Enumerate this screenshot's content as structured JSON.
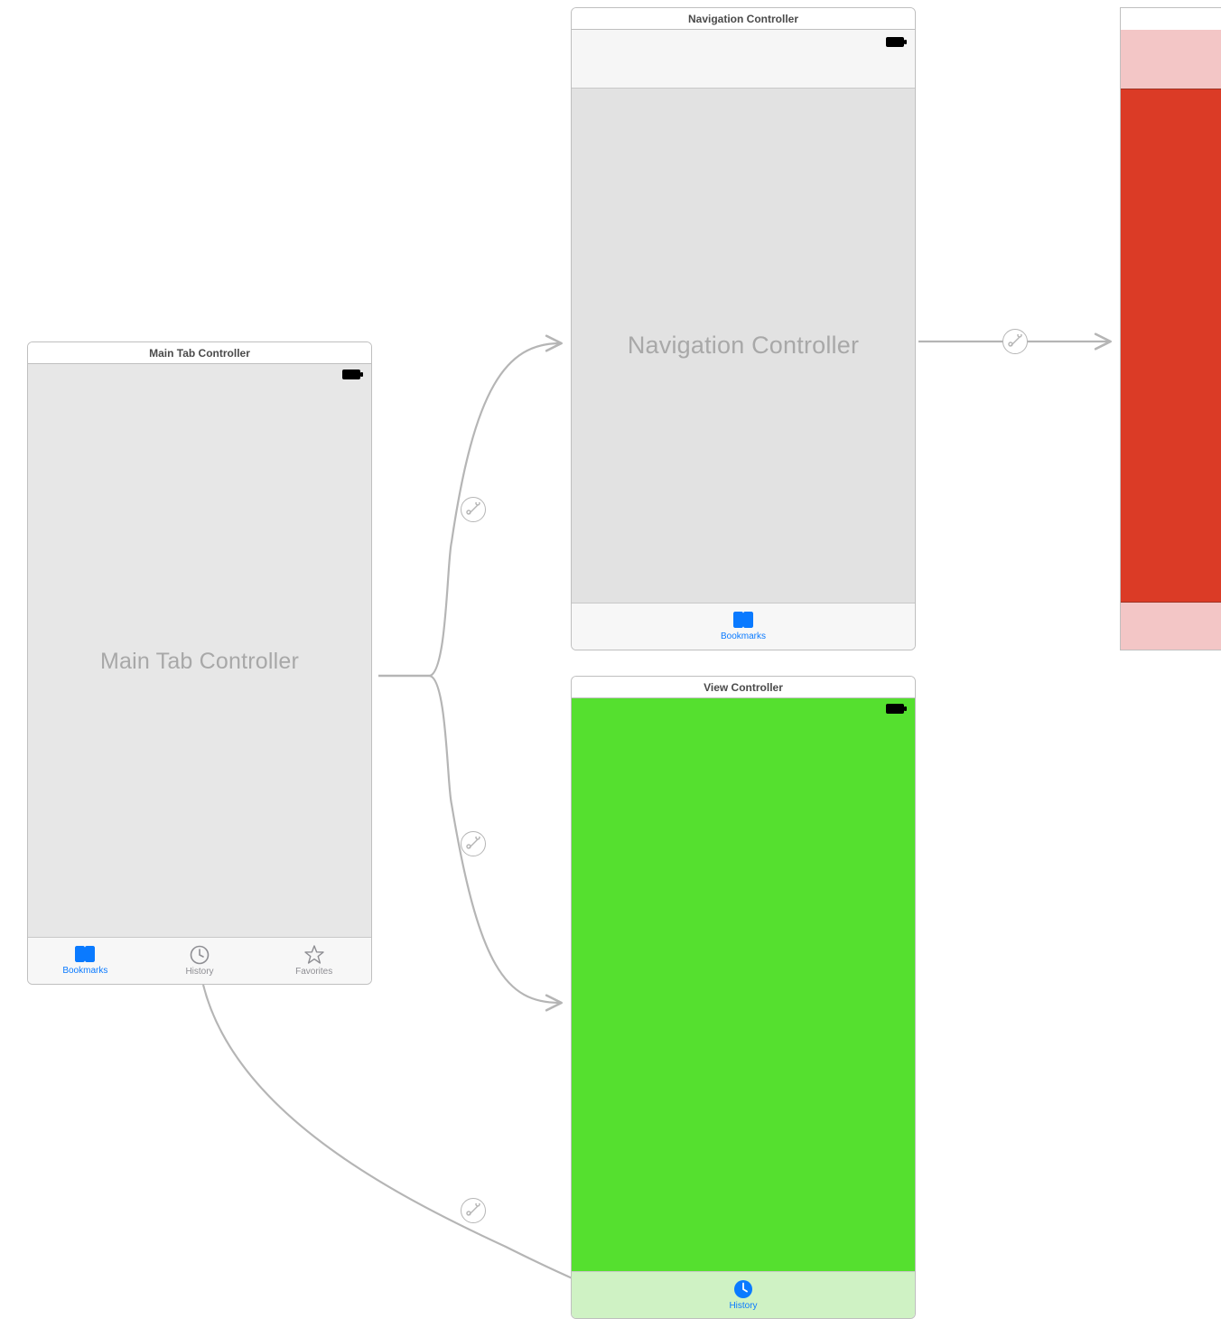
{
  "scenes": {
    "main": {
      "title": "Main Tab Controller",
      "placeholder": "Main Tab Controller",
      "tabs": [
        {
          "label": "Bookmarks",
          "icon": "bookmarks",
          "active": true
        },
        {
          "label": "History",
          "icon": "history",
          "active": false
        },
        {
          "label": "Favorites",
          "icon": "favorites",
          "active": false
        }
      ]
    },
    "nav": {
      "title": "Navigation Controller",
      "placeholder": "Navigation Controller",
      "tabs": [
        {
          "label": "Bookmarks",
          "icon": "bookmarks",
          "active": true
        }
      ]
    },
    "green": {
      "title": "View Controller",
      "tabs": [
        {
          "label": "History",
          "icon": "history",
          "active": true
        }
      ]
    },
    "red": {
      "title": ""
    }
  },
  "colors": {
    "tint_active": "#0a7aff",
    "tint_inactive": "#8e8e93"
  }
}
